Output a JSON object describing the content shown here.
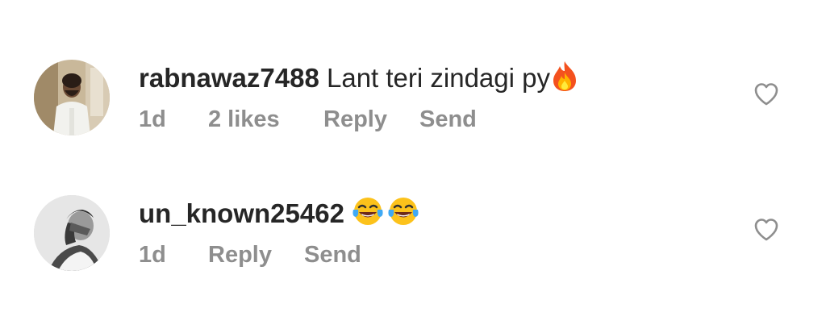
{
  "comments": [
    {
      "username": "rabnawaz7488",
      "text": "Lant teri zindagi py",
      "emoji": [
        "fire-emoji"
      ],
      "time": "1d",
      "likes": "2 likes",
      "reply_label": "Reply",
      "send_label": "Send",
      "like_icon": "heart-outline-icon"
    },
    {
      "username": "un_known25462",
      "text": "",
      "emoji": [
        "face-with-tears-of-joy-emoji",
        "face-with-tears-of-joy-emoji"
      ],
      "time": "1d",
      "reply_label": "Reply",
      "send_label": "Send",
      "like_icon": "heart-outline-icon"
    }
  ],
  "colors": {
    "username": "#262626",
    "meta": "#8e8e8e",
    "heart": "#8e8e8e",
    "background": "#ffffff"
  }
}
